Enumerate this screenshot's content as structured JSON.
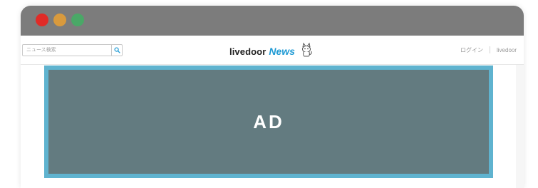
{
  "colors": {
    "titlebar": "#7c7c7c",
    "close": "#e02b27",
    "minimize": "#d99a3d",
    "zoom": "#4aa867",
    "news_accent": "#1f9ad4",
    "ad_fill": "#637b80",
    "ad_border": "#5fb3cf"
  },
  "window": {
    "buttons": [
      "close",
      "minimize",
      "zoom"
    ]
  },
  "header": {
    "search": {
      "placeholder": "ニュース検索",
      "icon": "search-icon"
    },
    "logo": {
      "main": "livedoor",
      "accent": "News",
      "mascot_icon": "mascot-icon"
    },
    "links": {
      "login": "ログイン",
      "home": "livedoor"
    }
  },
  "ad": {
    "label": "AD"
  }
}
